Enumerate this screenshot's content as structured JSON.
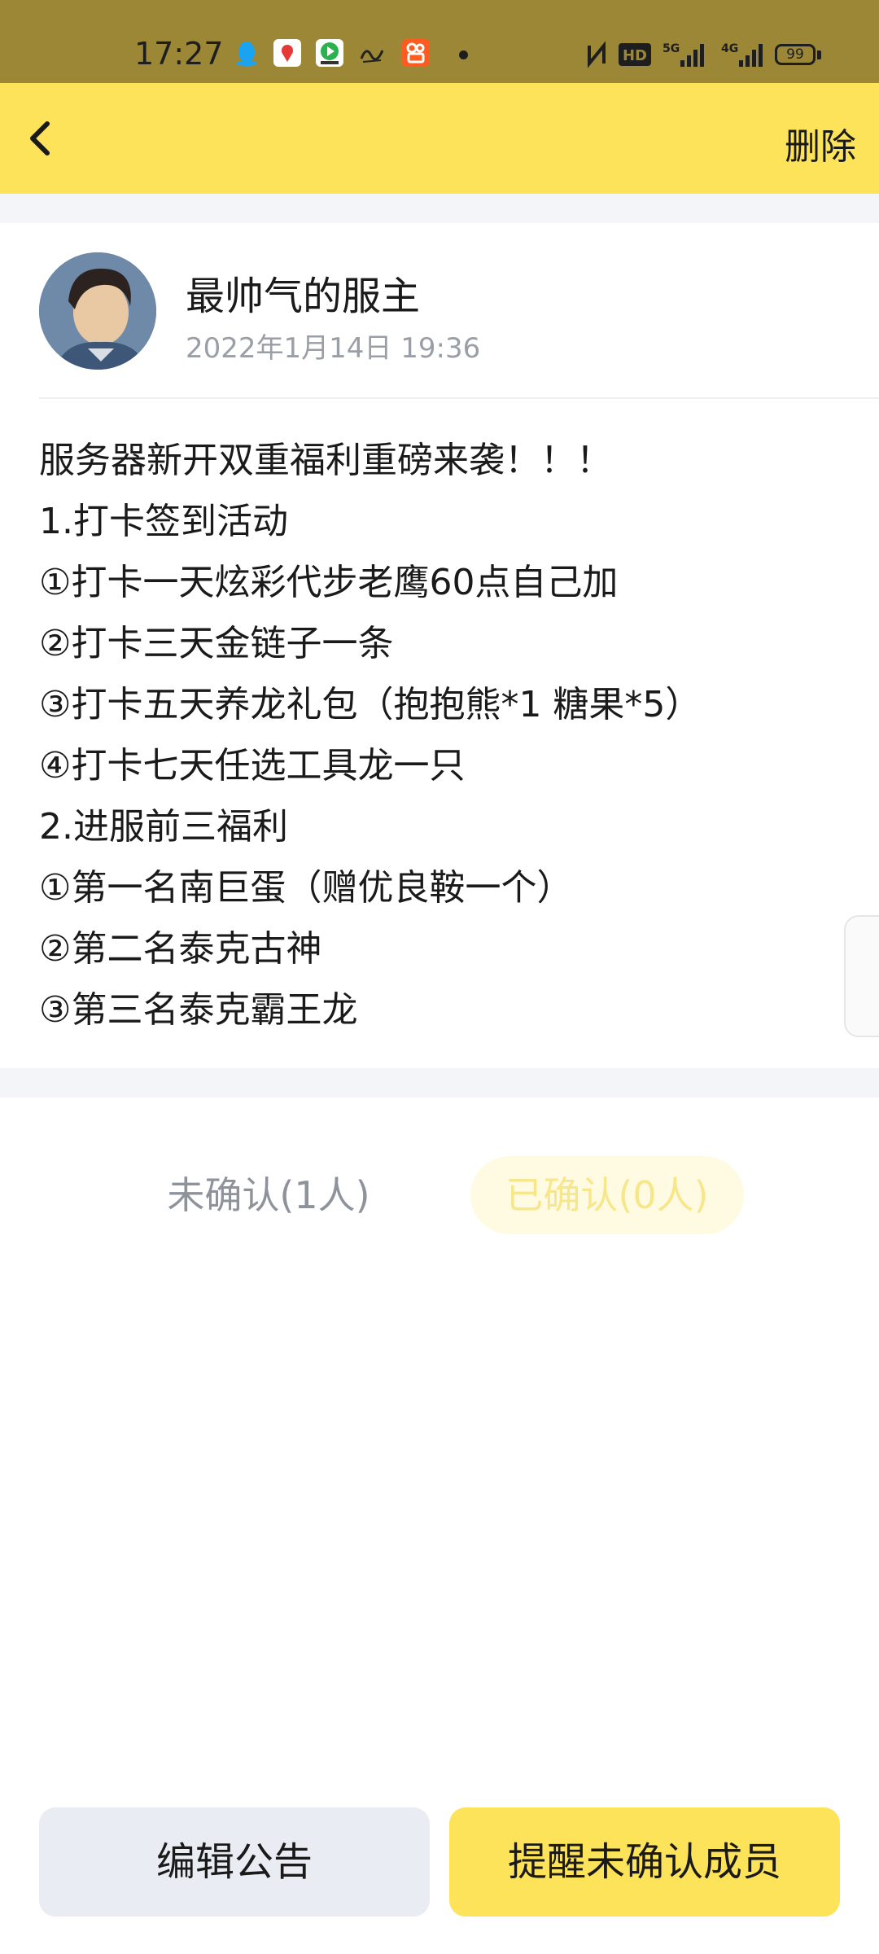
{
  "status_bar": {
    "time": "17:27",
    "app_icons": [
      "qq-icon",
      "maps-icon",
      "video-icon",
      "xuexi-icon",
      "kuaishou-icon"
    ],
    "right_icons": [
      "nfc-icon",
      "hd-icon",
      "5g-signal-icon",
      "4g-signal-icon"
    ],
    "battery": "99"
  },
  "nav": {
    "back_icon": "chevron-left-icon",
    "delete_label": "删除"
  },
  "author": {
    "name": "最帅气的服主",
    "time": "2022年1月14日 19:36"
  },
  "content": {
    "lines": [
      "服务器新开双重福利重磅来袭！！！",
      "1.打卡签到活动",
      "①打卡一天炫彩代步老鹰60点自己加",
      "②打卡三天金链子一条",
      "③打卡五天养龙礼包（抱抱熊*1 糖果*5）",
      "④打卡七天任选工具龙一只",
      "2.进服前三福利",
      "①第一名南巨蛋（赠优良鞍一个）",
      "②第二名泰克古神",
      "③第三名泰克霸王龙"
    ]
  },
  "tabs": {
    "unconfirmed": "未确认(1人)",
    "confirmed": "已确认(0人)"
  },
  "buttons": {
    "edit": "编辑公告",
    "remind": "提醒未确认成员"
  },
  "colors": {
    "accent": "#fde359",
    "status_bar": "#9b8736",
    "muted_text": "#9a9ea6"
  }
}
